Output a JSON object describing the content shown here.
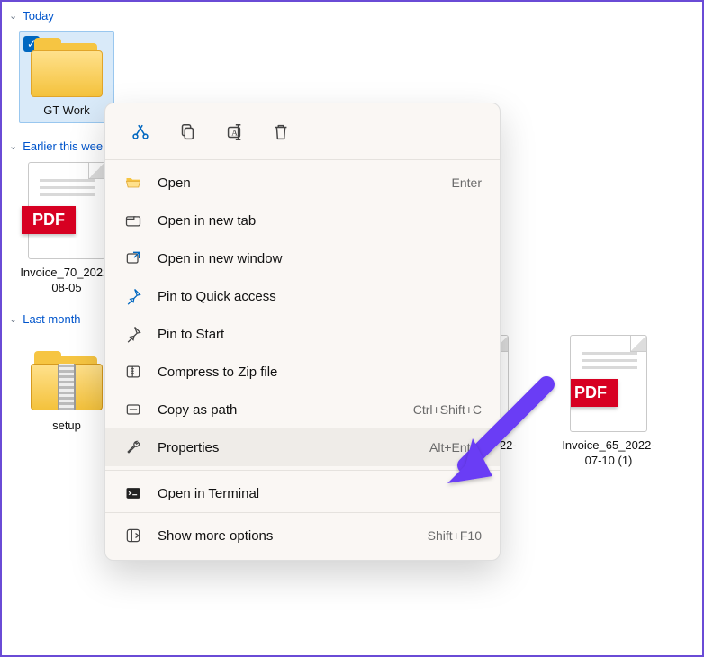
{
  "groups": {
    "today": {
      "label": "Today"
    },
    "earlier_week": {
      "label": "Earlier this week"
    },
    "last_month": {
      "label": "Last month"
    }
  },
  "files": {
    "today": [
      {
        "label": "GT Work"
      }
    ],
    "earlier_week": [
      {
        "label": "Invoice_70_2022-08-05"
      }
    ],
    "last_month": [
      {
        "label": "setup"
      },
      {
        "label": "Invoice_66_2022-07-10"
      },
      {
        "label": "Invoice_65_2022-07-10 (1)"
      }
    ]
  },
  "context_menu": {
    "open": {
      "label": "Open",
      "accel": "Enter"
    },
    "open_new_tab": {
      "label": "Open in new tab"
    },
    "open_new_window": {
      "label": "Open in new window"
    },
    "pin_quick": {
      "label": "Pin to Quick access"
    },
    "pin_start": {
      "label": "Pin to Start"
    },
    "compress_zip": {
      "label": "Compress to Zip file"
    },
    "copy_as_path": {
      "label": "Copy as path",
      "accel": "Ctrl+Shift+C"
    },
    "properties": {
      "label": "Properties",
      "accel": "Alt+Enter"
    },
    "open_terminal": {
      "label": "Open in Terminal"
    },
    "show_more": {
      "label": "Show more options",
      "accel": "Shift+F10"
    }
  }
}
